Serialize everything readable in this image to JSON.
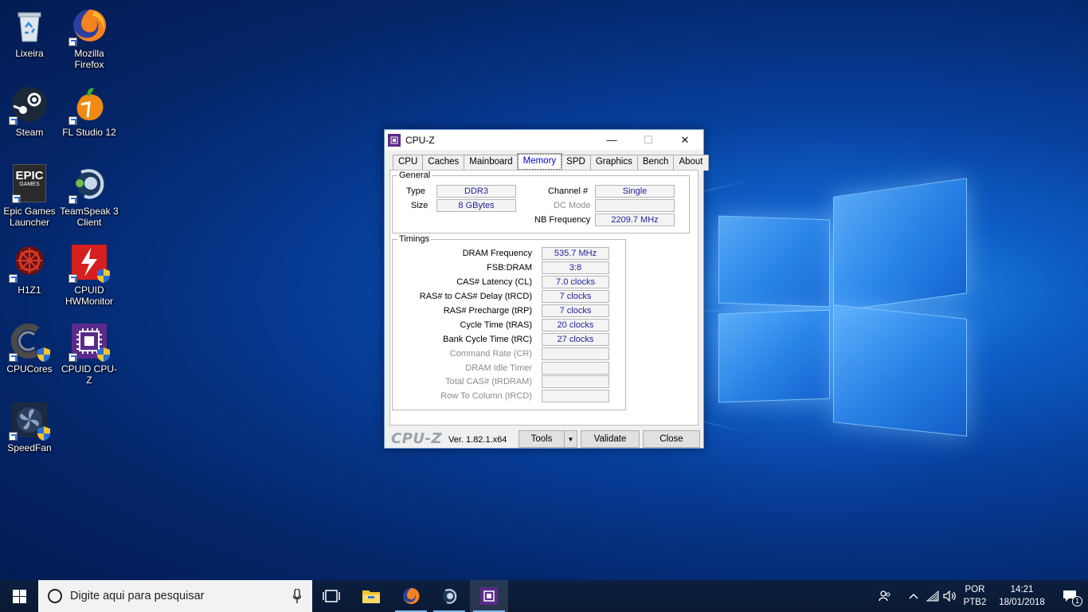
{
  "desktop": {
    "icons": [
      {
        "label": "Lixeira"
      },
      {
        "label": "Mozilla Firefox"
      },
      {
        "label": "Steam"
      },
      {
        "label": "FL Studio 12"
      },
      {
        "label": "Epic Games Launcher"
      },
      {
        "label": "TeamSpeak 3 Client"
      },
      {
        "label": "H1Z1"
      },
      {
        "label": "CPUID HWMonitor"
      },
      {
        "label": "CPUCores"
      },
      {
        "label": "CPUID CPU-Z"
      },
      {
        "label": "SpeedFan"
      }
    ],
    "epic_logo_text": "EPIC",
    "epic_logo_sub": "GAMES"
  },
  "window": {
    "title": "CPU-Z",
    "controls": {
      "minimize": "—",
      "maximize": "☐",
      "close": "✕"
    },
    "tabs": [
      "CPU",
      "Caches",
      "Mainboard",
      "Memory",
      "SPD",
      "Graphics",
      "Bench",
      "About"
    ],
    "active_tab": "Memory",
    "general": {
      "legend": "General",
      "type_label": "Type",
      "type_value": "DDR3",
      "size_label": "Size",
      "size_value": "8 GBytes",
      "channel_label": "Channel #",
      "channel_value": "Single",
      "dcmode_label": "DC Mode",
      "dcmode_value": "",
      "nbfreq_label": "NB Frequency",
      "nbfreq_value": "2209.7 MHz"
    },
    "timings": {
      "legend": "Timings",
      "rows": [
        {
          "label": "DRAM Frequency",
          "value": "535.7 MHz",
          "disabled": false
        },
        {
          "label": "FSB:DRAM",
          "value": "3:8",
          "disabled": false
        },
        {
          "label": "CAS# Latency (CL)",
          "value": "7.0 clocks",
          "disabled": false
        },
        {
          "label": "RAS# to CAS# Delay (tRCD)",
          "value": "7 clocks",
          "disabled": false
        },
        {
          "label": "RAS# Precharge (tRP)",
          "value": "7 clocks",
          "disabled": false
        },
        {
          "label": "Cycle Time (tRAS)",
          "value": "20 clocks",
          "disabled": false
        },
        {
          "label": "Bank Cycle Time (tRC)",
          "value": "27 clocks",
          "disabled": false
        },
        {
          "label": "Command Rate (CR)",
          "value": "",
          "disabled": true
        },
        {
          "label": "DRAM Idle Timer",
          "value": "",
          "disabled": true
        },
        {
          "label": "Total CAS# (tRDRAM)",
          "value": "",
          "disabled": true
        },
        {
          "label": "Row To Column (tRCD)",
          "value": "",
          "disabled": true
        }
      ]
    },
    "footer": {
      "brand": "CPU-Z",
      "version": "Ver. 1.82.1.x64",
      "tools_label": "Tools",
      "tools_arrow": "▼",
      "validate_label": "Validate",
      "close_label": "Close"
    }
  },
  "taskbar": {
    "search_placeholder": "Digite aqui para pesquisar",
    "pinned": [
      "task-view",
      "file-explorer",
      "firefox",
      "teamspeak",
      "cpu-z"
    ],
    "language": "POR",
    "keyboard": "PTB2",
    "time": "14:21",
    "date": "18/01/2018",
    "notification_count": "1"
  },
  "colors": {
    "value_text": "#22229a",
    "active_tab_text": "#0000cc",
    "taskbar_bg": "#0a1a33",
    "accent": "#76b9ed"
  }
}
